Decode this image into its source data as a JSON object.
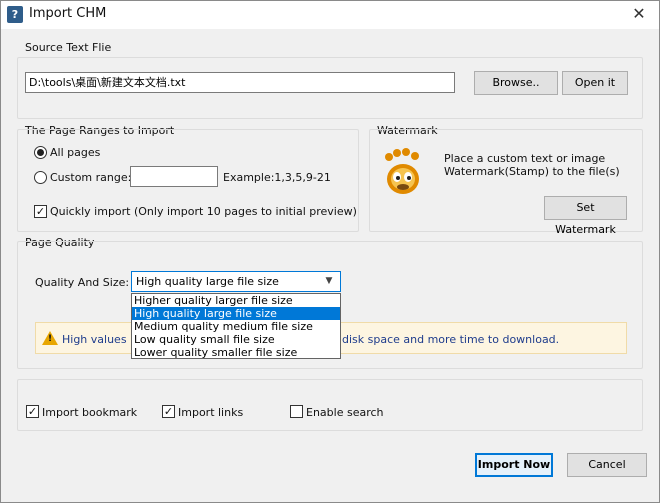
{
  "window": {
    "title": "Import CHM"
  },
  "source": {
    "legend": "Source Text Flie",
    "path_value": "D:\\tools\\桌面\\新建文本文档.txt",
    "browse_label": "Browse..",
    "open_label": "Open it"
  },
  "ranges": {
    "legend": "The Page Ranges to Import",
    "all_pages_label": "All pages",
    "custom_range_label": "Custom range:",
    "custom_range_value": "",
    "example_label": "Example:1,3,5,9-21",
    "quick_import_label": "Quickly import (Only import 10 pages to  initial  preview)",
    "all_pages_checked": true,
    "custom_checked": false,
    "quick_checked": true
  },
  "watermark": {
    "legend": "Watermark",
    "description_line1": "Place a custom text or image",
    "description_line2": "Watermark(Stamp) to the file(s)",
    "button_label": "Set Watermark",
    "icon": "gimp-mascot-icon"
  },
  "quality": {
    "legend": "Page Quality",
    "field_label": "Quality And Size:",
    "selected": "High quality large file size",
    "options": [
      "Higher quality larger file size",
      "High quality large file size",
      "Medium quality medium file size",
      "Low quality small file size",
      "Lower quality smaller file size"
    ],
    "selected_index": 1,
    "warning_left": "High values pr",
    "warning_right": "disk space and more time to download."
  },
  "options": {
    "import_bookmark_label": "Import bookmark",
    "import_links_label": "Import links",
    "enable_search_label": "Enable search",
    "import_bookmark_checked": true,
    "import_links_checked": true,
    "enable_search_checked": false
  },
  "footer": {
    "import_now_label": "Import Now",
    "cancel_label": "Cancel"
  },
  "colors": {
    "accent": "#0078d7",
    "warning_bg": "#fdf5e1",
    "warning_text": "#1e3c8c"
  }
}
